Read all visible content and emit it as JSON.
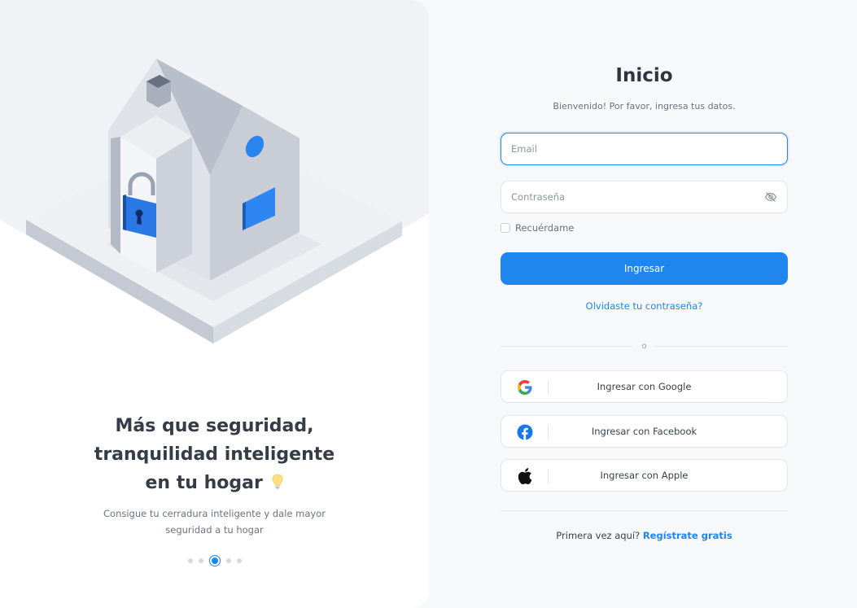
{
  "hero": {
    "title_line1": "Más que seguridad,",
    "title_line2": "tranquilidad inteligente",
    "title_line3": "en tu hogar",
    "subtitle": "Consigue tu cerradura inteligente y dale mayor seguridad a tu hogar",
    "carousel": {
      "total": 5,
      "active_index": 2
    }
  },
  "login": {
    "title": "Inicio",
    "subtitle": "Bienvenido! Por favor, ingresa tus datos.",
    "email": {
      "placeholder": "Email",
      "value": ""
    },
    "password": {
      "placeholder": "Contraseña",
      "value": ""
    },
    "remember_label": "Recuérdame",
    "submit_label": "Ingresar",
    "forgot_label": "Olvidaste tu contraseña?",
    "or_label": "o",
    "social": {
      "google_label": "Ingresar con Google",
      "facebook_label": "Ingresar con Facebook",
      "apple_label": "Ingresar con Apple"
    },
    "signup_prompt": "Primera vez aquí?",
    "signup_link": "Regístrate gratis"
  },
  "colors": {
    "accent": "#1f86ef",
    "page_bg": "#f7f8fa",
    "panel_bg": "#ffffff",
    "heading": "#353c47"
  },
  "icons": [
    "house-lock-illustration",
    "lightbulb-icon",
    "eye-off-icon",
    "google-icon",
    "facebook-icon",
    "apple-icon"
  ]
}
